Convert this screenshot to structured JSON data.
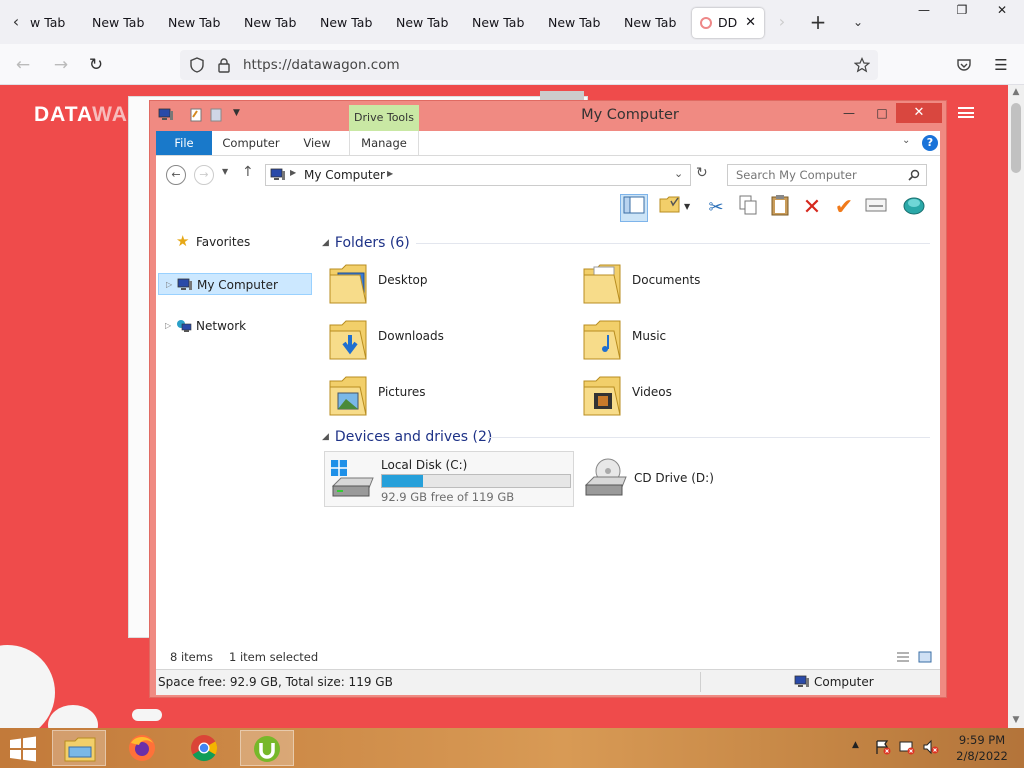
{
  "browser": {
    "tabs": [
      {
        "label": "w Tab"
      },
      {
        "label": "New Tab"
      },
      {
        "label": "New Tab"
      },
      {
        "label": "New Tab"
      },
      {
        "label": "New Tab"
      },
      {
        "label": "New Tab"
      },
      {
        "label": "New Tab"
      },
      {
        "label": "New Tab"
      },
      {
        "label": "New Tab"
      }
    ],
    "active_tab_label": "DD",
    "url": "https://datawagon.com"
  },
  "page": {
    "logo_main": "DATA",
    "logo_faded": "WA"
  },
  "explorer": {
    "title": "My Computer",
    "context_tab": "Drive Tools",
    "ribbon_tabs": {
      "file": "File",
      "computer": "Computer",
      "view": "View",
      "manage": "Manage"
    },
    "address": "My Computer",
    "search_placeholder": "Search My Computer",
    "nav": {
      "favorites": "Favorites",
      "my_computer": "My Computer",
      "network": "Network"
    },
    "folders_header": "Folders (6)",
    "folders": [
      "Desktop",
      "Documents",
      "Downloads",
      "Music",
      "Pictures",
      "Videos"
    ],
    "drives_header": "Devices and drives (2)",
    "drive_c": {
      "label": "Local Disk (C:)",
      "free_text": "92.9 GB free of 119 GB",
      "used_fraction": 0.22
    },
    "drive_d": {
      "label": "CD Drive (D:)"
    },
    "status_items": "8 items",
    "status_selected": "1 item selected",
    "space_text": "Space free: 92.9 GB, Total size: 119 GB",
    "location": "Computer"
  },
  "taskbar": {
    "time": "9:59 PM",
    "date": "2/8/2022"
  },
  "colors": {
    "page_bg": "#ef4b4b",
    "explorer_frame": "#f08a82",
    "file_tab": "#1979ca",
    "drive_tools": "#c9e8a4",
    "progress": "#26a0da"
  }
}
